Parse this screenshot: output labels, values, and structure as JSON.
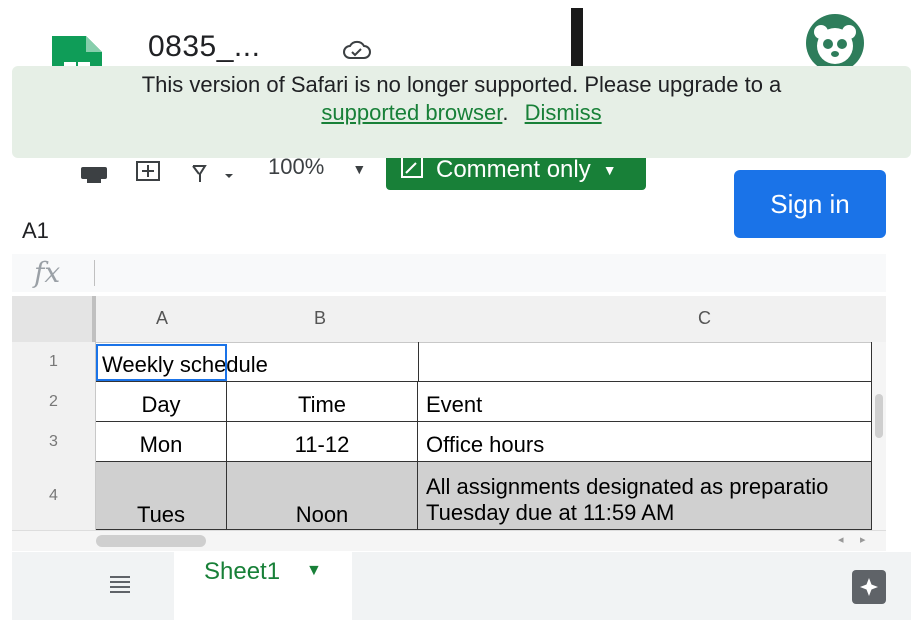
{
  "header": {
    "doc_title": "0835_...",
    "brand_color": "#188038"
  },
  "banner": {
    "message": "This version of Safari is no longer supported. Please upgrade to a",
    "link_supported": "supported browser",
    "sep": ".",
    "link_dismiss": "Dismiss"
  },
  "toolbar": {
    "zoom": "100%",
    "comment_label": "Comment only",
    "signin_label": "Sign in"
  },
  "formula": {
    "name_box": "A1",
    "fx": "fx"
  },
  "grid": {
    "columns": [
      "A",
      "B",
      "C"
    ],
    "rows": [
      "1",
      "2",
      "3",
      "4"
    ],
    "r1c1": "Weekly schedule",
    "r2": [
      "Day",
      "Time",
      "Event"
    ],
    "r3": [
      "Mon",
      "11-12",
      "Office hours"
    ],
    "r4": [
      "Tues",
      "Noon",
      "All assignments designated as preparatio"
    ],
    "r4c3_line2": "Tuesday due at 11:59 AM"
  },
  "tabs": {
    "sheet_name": "Sheet1"
  }
}
